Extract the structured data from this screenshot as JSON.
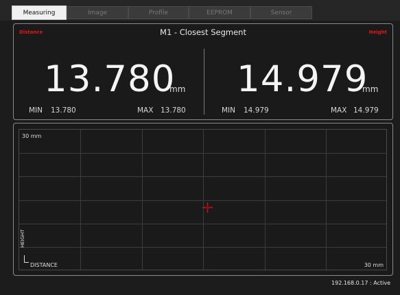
{
  "tabs": [
    {
      "label": "Measuring",
      "active": true
    },
    {
      "label": "Image",
      "active": false
    },
    {
      "label": "Profile",
      "active": false
    },
    {
      "label": "EEPROM",
      "active": false
    },
    {
      "label": "Sensor",
      "active": false
    }
  ],
  "measure": {
    "left_label": "Distance",
    "right_label": "Height",
    "title": "M1 - Closest Segment",
    "distance": {
      "value": "13.780",
      "unit": "mm",
      "min_label": "MIN",
      "min": "13.780",
      "max_label": "MAX",
      "max": "13.780"
    },
    "height": {
      "value": "14.979",
      "unit": "mm",
      "min_label": "MIN",
      "min": "14.979",
      "max_label": "MAX",
      "max": "14.979"
    }
  },
  "plot": {
    "y_max_label": "30 mm",
    "x_max_label": "30 mm",
    "y_axis_label": "HEIGHT",
    "x_axis_label": "DISTANCE",
    "point_color": "#c0141e"
  },
  "status": "192.168.0.17 : Active",
  "colors": {
    "accent_red": "#e01818",
    "background": "#1c1c1c"
  }
}
